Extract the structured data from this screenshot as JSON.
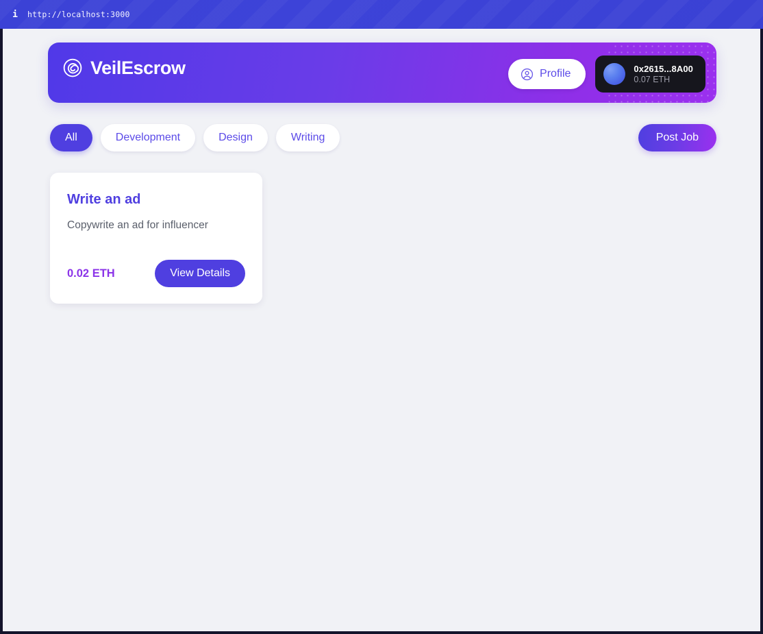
{
  "browser": {
    "info_icon": "info-icon",
    "url": "http://localhost:3000"
  },
  "header": {
    "logo_icon": "spiral-logo-icon",
    "brand_name": "VeilEscrow",
    "profile": {
      "icon": "user-circle-icon",
      "label": "Profile"
    },
    "wallet": {
      "avatar_icon": "wallet-avatar",
      "address": "0x2615...8A00",
      "balance": "0.07 ETH"
    },
    "gradient_from": "#5039e8",
    "gradient_to": "#9b30ef"
  },
  "filters": {
    "pills": [
      {
        "label": "All",
        "active": true
      },
      {
        "label": "Development",
        "active": false
      },
      {
        "label": "Design",
        "active": false
      },
      {
        "label": "Writing",
        "active": false
      }
    ],
    "post_job_label": "Post Job"
  },
  "jobs": [
    {
      "title": "Write an ad",
      "description": "Copywrite an ad for influencer",
      "price": "0.02 ETH",
      "action_label": "View Details"
    }
  ],
  "colors": {
    "page_background": "#f1f2f6",
    "primary": "#4f3fe0",
    "accent_purple": "#8b33e8",
    "wallet_chip_bg": "#16161d"
  }
}
